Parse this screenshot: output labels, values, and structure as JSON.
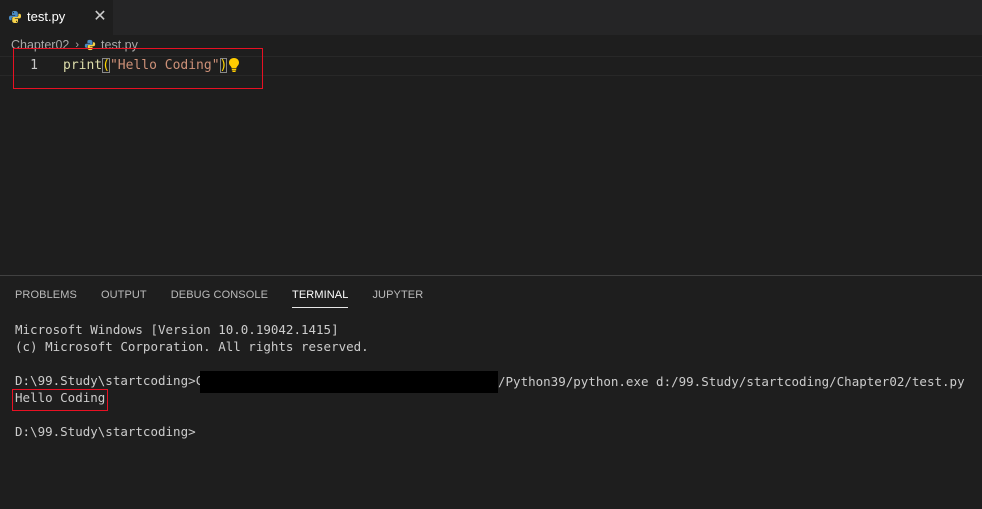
{
  "tab": {
    "file_name": "test.py",
    "close_glyph": "✕"
  },
  "breadcrumb": {
    "folder": "Chapter02",
    "separator": "›",
    "file": "test.py"
  },
  "editor": {
    "line_number": "1",
    "code": {
      "fn": "print",
      "open_paren": "(",
      "string": "\"Hello Coding\"",
      "close_paren": ")"
    },
    "lightbulb_icon": "lightbulb-icon"
  },
  "panel": {
    "tabs": [
      "PROBLEMS",
      "OUTPUT",
      "DEBUG CONSOLE",
      "TERMINAL",
      "JUPYTER"
    ],
    "active_tab": "TERMINAL"
  },
  "terminal": {
    "line1": "Microsoft Windows [Version 10.0.19042.1415]",
    "line2": "(c) Microsoft Corporation. All rights reserved.",
    "line3": "",
    "cmd_prefix": "D:\\99.Study\\startcoding>C:/",
    "cmd_suffix": "/Python39/python.exe d:/99.Study/startcoding/Chapter02/test.py",
    "output": "Hello Coding",
    "line6": "",
    "prompt": "D:\\99.Study\\startcoding>"
  },
  "colors": {
    "editor_bg": "#1e1e1e",
    "function": "#dcdcaa",
    "string": "#ce9178",
    "annotation_box": "#e81123"
  }
}
